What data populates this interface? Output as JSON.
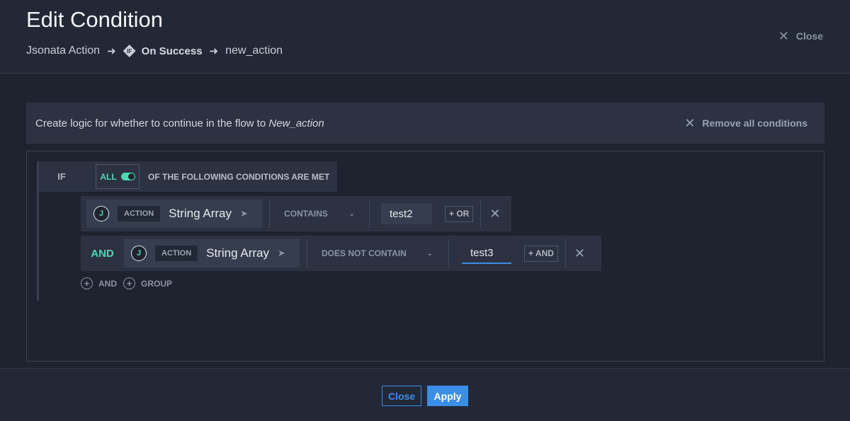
{
  "header": {
    "title": "Edit Condition",
    "breadcrumb": [
      "Jsonata Action",
      "On Success",
      "new_action"
    ],
    "close_label": "Close",
    "if_badge": "IF"
  },
  "info": {
    "prefix": "Create logic for whether to continue in the flow to",
    "target": "New_action",
    "remove_all_label": "Remove all conditions"
  },
  "editor": {
    "if_label": "IF",
    "match_mode": "ALL",
    "match_text": "OF THE FOLLOWING CONDITIONS ARE MET",
    "conditions": [
      {
        "connector": "",
        "source_icon": "J",
        "source_tag": "ACTION",
        "property": "String Array",
        "operator": "CONTAINS",
        "value": "test2",
        "logic_button": "+ OR"
      },
      {
        "connector": "AND",
        "source_icon": "J",
        "source_tag": "ACTION",
        "property": "String Array",
        "operator": "DOES NOT CONTAIN",
        "value": "test3",
        "logic_button": "+ AND"
      }
    ],
    "add_and_label": "AND",
    "add_group_label": "GROUP"
  },
  "footer": {
    "close_label": "Close",
    "apply_label": "Apply"
  },
  "colors": {
    "accent_teal": "#4fd8b5",
    "accent_blue": "#3a8ee6",
    "background": "#1f2330",
    "panel": "#2c3242"
  }
}
